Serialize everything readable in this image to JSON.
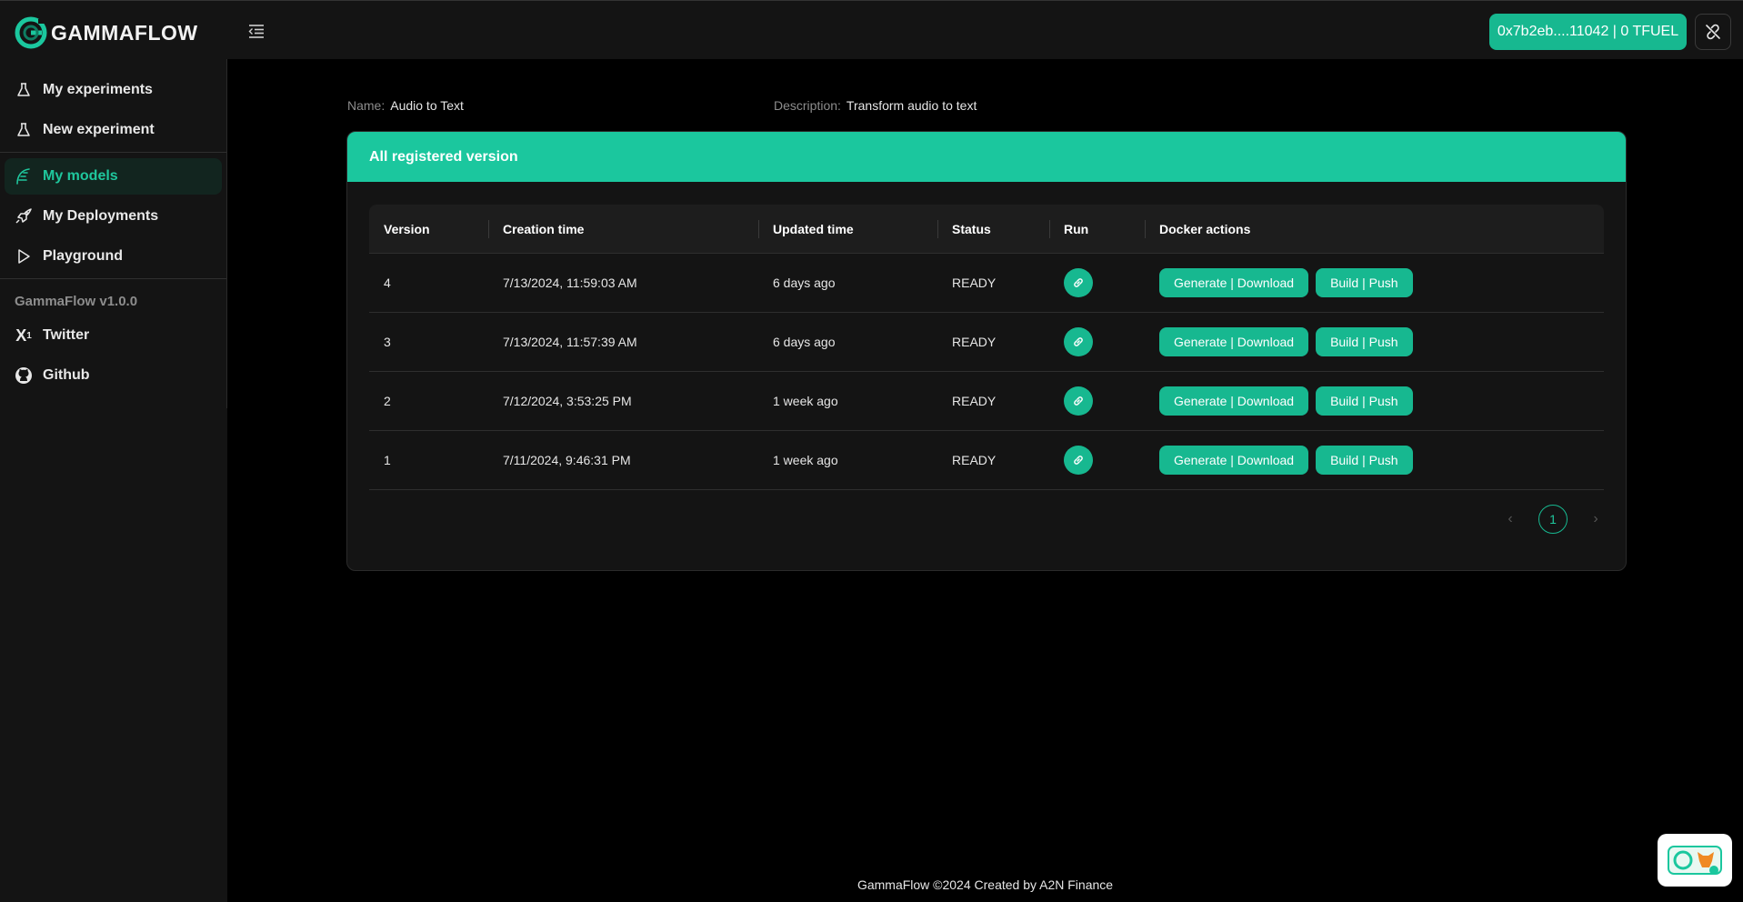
{
  "header": {
    "logo_text": "GAMMAFLOW",
    "wallet_label": "0x7b2eb....11042 | 0 TFUEL",
    "accent": "#17b890"
  },
  "sidebar": {
    "items": [
      {
        "label": "My experiments",
        "icon": "flask-icon"
      },
      {
        "label": "New experiment",
        "icon": "flask-icon"
      },
      {
        "label": "My models",
        "icon": "model-icon",
        "active": true
      },
      {
        "label": "My Deployments",
        "icon": "rocket-icon"
      },
      {
        "label": "Playground",
        "icon": "play-icon"
      }
    ],
    "version": "GammaFlow v1.0.0",
    "links": [
      {
        "label": "Twitter",
        "icon": "x-icon"
      },
      {
        "label": "Github",
        "icon": "github-icon"
      }
    ]
  },
  "model": {
    "name_label": "Name:",
    "name": "Audio to Text",
    "description_label": "Description:",
    "description": "Transform audio to text"
  },
  "card": {
    "title": "All registered version",
    "columns": [
      "Version",
      "Creation time",
      "Updated time",
      "Status",
      "Run",
      "Docker actions"
    ],
    "rows": [
      {
        "version": "4",
        "created": "7/13/2024, 11:59:03 AM",
        "updated": "6 days ago",
        "status": "READY"
      },
      {
        "version": "3",
        "created": "7/13/2024, 11:57:39 AM",
        "updated": "6 days ago",
        "status": "READY"
      },
      {
        "version": "2",
        "created": "7/12/2024, 3:53:25 PM",
        "updated": "1 week ago",
        "status": "READY"
      },
      {
        "version": "1",
        "created": "7/11/2024, 9:46:31 PM",
        "updated": "1 week ago",
        "status": "READY"
      }
    ],
    "actions": {
      "generate": "Generate | Download",
      "build": "Build | Push"
    },
    "pagination": {
      "current": "1"
    }
  },
  "footer": "GammaFlow ©2024 Created by A2N Finance"
}
